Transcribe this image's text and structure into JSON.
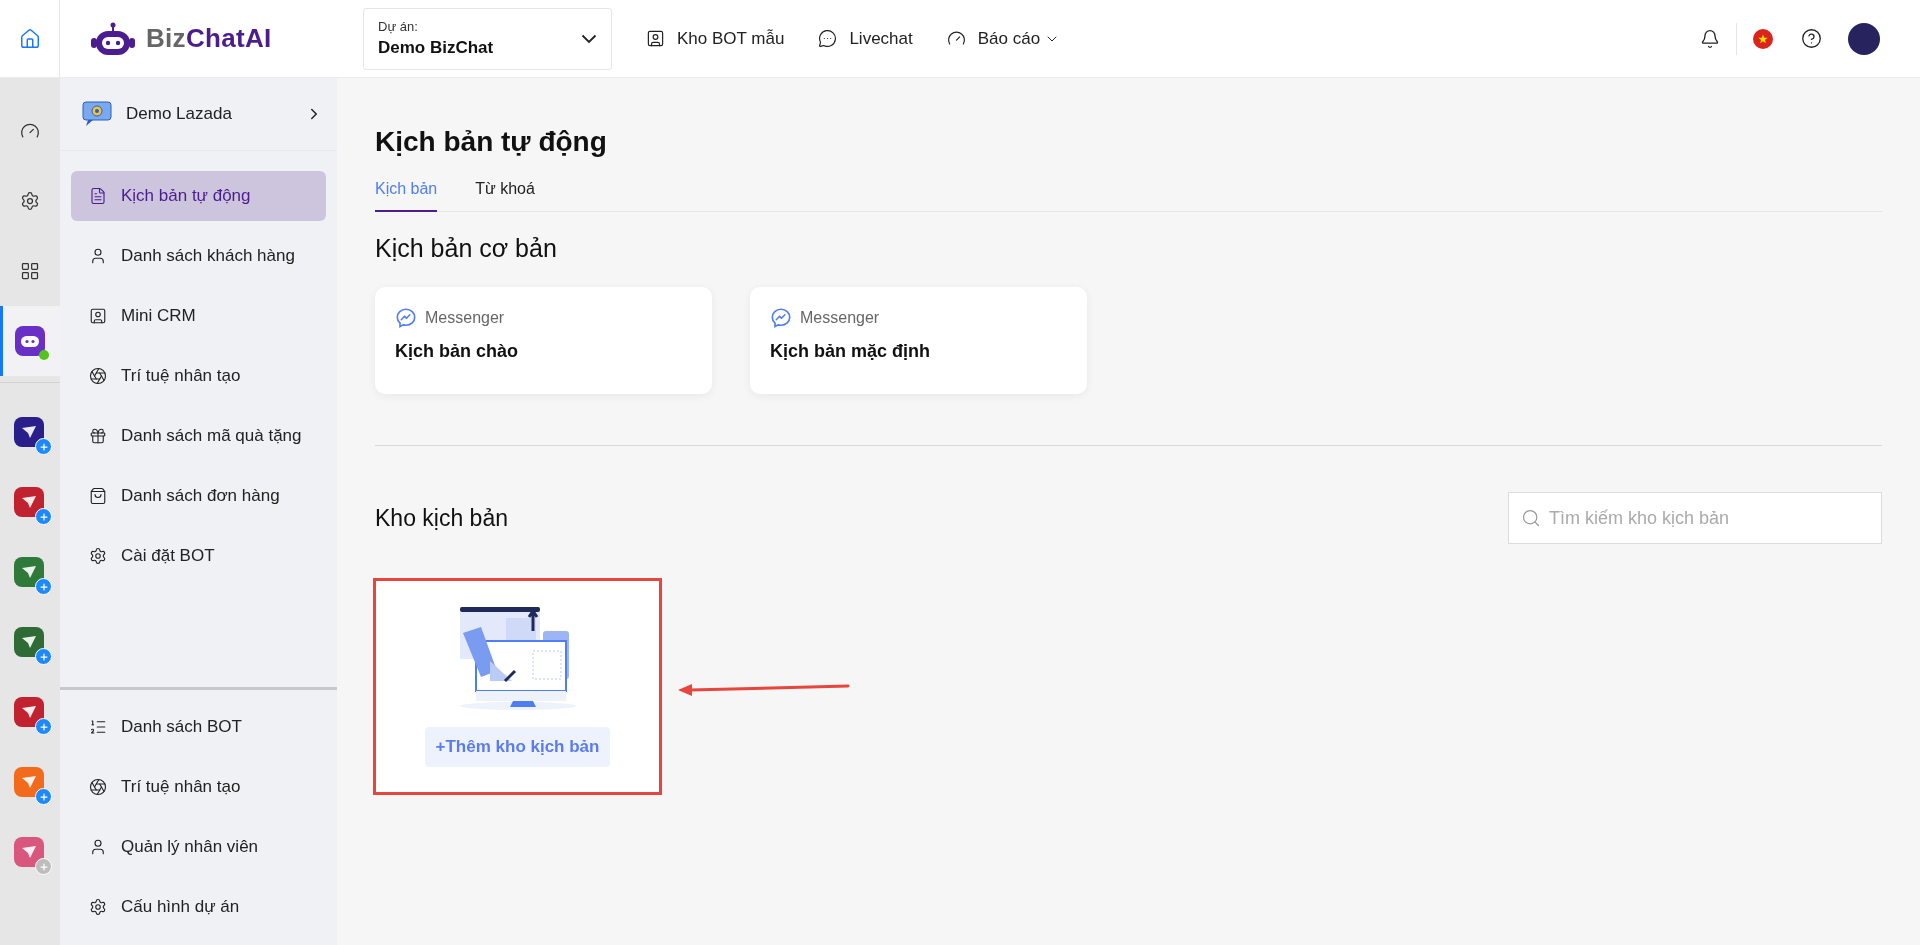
{
  "header": {
    "logo": {
      "prefix": "Biz",
      "name": "ChatAI"
    },
    "project": {
      "label": "Dự án:",
      "value": "Demo BizChat"
    },
    "nav": [
      {
        "label": "Kho BOT mẫu",
        "has_menu": false
      },
      {
        "label": "Livechat",
        "has_menu": false
      },
      {
        "label": "Báo cáo",
        "has_menu": true
      }
    ]
  },
  "rail": {
    "items": [
      {
        "selected": false
      },
      {
        "selected": false
      },
      {
        "selected": false
      },
      {
        "selected": true,
        "online": true
      }
    ],
    "apps": [
      {
        "color": "#2a1f8a",
        "disabled": false
      },
      {
        "color": "#c0222f",
        "disabled": false
      },
      {
        "color": "#2f7a3a",
        "disabled": false
      },
      {
        "color": "#2f6b34",
        "disabled": false
      },
      {
        "color": "#c0222f",
        "disabled": false
      },
      {
        "color": "#f26b1d",
        "disabled": false
      },
      {
        "color": "#d9577f",
        "disabled": true
      }
    ]
  },
  "sidebar": {
    "bot_name": "Demo Lazada",
    "items": [
      {
        "label": "Kịch bản tự động",
        "selected": true
      },
      {
        "label": "Danh sách khách hàng",
        "selected": false
      },
      {
        "label": "Mini CRM",
        "selected": false
      },
      {
        "label": "Trí tuệ nhân tạo",
        "selected": false
      },
      {
        "label": "Danh sách mã quà tặng",
        "selected": false
      },
      {
        "label": "Danh sách đơn hàng",
        "selected": false
      },
      {
        "label": "Cài đặt BOT",
        "selected": false
      }
    ],
    "bottom_items": [
      {
        "label": "Danh sách BOT",
        "selected": false
      },
      {
        "label": "Trí tuệ nhân tạo",
        "selected": false
      },
      {
        "label": "Quản lý nhân viên",
        "selected": false
      },
      {
        "label": "Cấu hình dự án",
        "selected": false
      }
    ]
  },
  "page": {
    "title": "Kịch bản tự động",
    "tabs": [
      {
        "label": "Kịch bản",
        "selected": true
      },
      {
        "label": "Từ khoá",
        "selected": false
      }
    ],
    "basic_title": "Kịch bản cơ bản",
    "basic_cards": [
      {
        "channel": "Messenger",
        "name": "Kịch bản chào"
      },
      {
        "channel": "Messenger",
        "name": "Kịch bản mặc định"
      }
    ],
    "library_title": "Kho kịch bản",
    "search": {
      "placeholder": "Tìm kiếm kho kịch bản"
    },
    "add_button": "+Thêm kho kịch bản"
  }
}
